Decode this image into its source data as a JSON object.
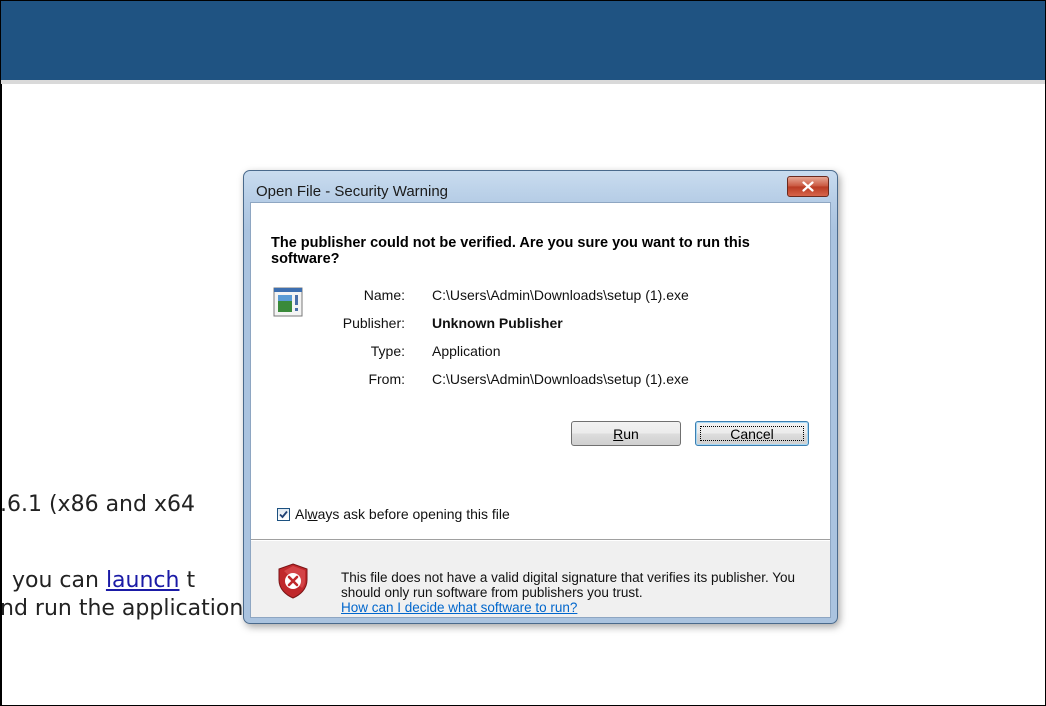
{
  "background_page": {
    "version_text": ".6.1 (x86 and x64",
    "launch_prefix": " you can ",
    "launch_link": "launch",
    "launch_suffix": " t",
    "run_text": "nd run the application."
  },
  "dialog": {
    "title": "Open File - Security Warning",
    "close_icon": "close-icon",
    "headline": "The publisher could not be verified.  Are you sure you want to run this software?",
    "file_icon": "application-file-icon",
    "fields": [
      {
        "label": "Name:",
        "value": "C:\\Users\\Admin\\Downloads\\setup (1).exe",
        "bold": false
      },
      {
        "label": "Publisher:",
        "value": "Unknown Publisher",
        "bold": true
      },
      {
        "label": "Type:",
        "value": "Application",
        "bold": false
      },
      {
        "label": "From:",
        "value": "C:\\Users\\Admin\\Downloads\\setup (1).exe",
        "bold": false
      }
    ],
    "run_button": {
      "accel": "R",
      "rest": "un"
    },
    "cancel_button": "Cancel",
    "checkbox": {
      "checked": true,
      "label_prefix": "Al",
      "label_accel": "w",
      "label_rest": "ays ask before opening this file"
    },
    "warning": {
      "icon": "shield-error-icon",
      "text": "This file does not have a valid digital signature that verifies its publisher.  You should only run software from publishers you trust.",
      "link": "How can I decide what software to run?"
    }
  },
  "colors": {
    "banner": "#1f5382",
    "link": "#0066cc",
    "shield": "#c0282b"
  }
}
